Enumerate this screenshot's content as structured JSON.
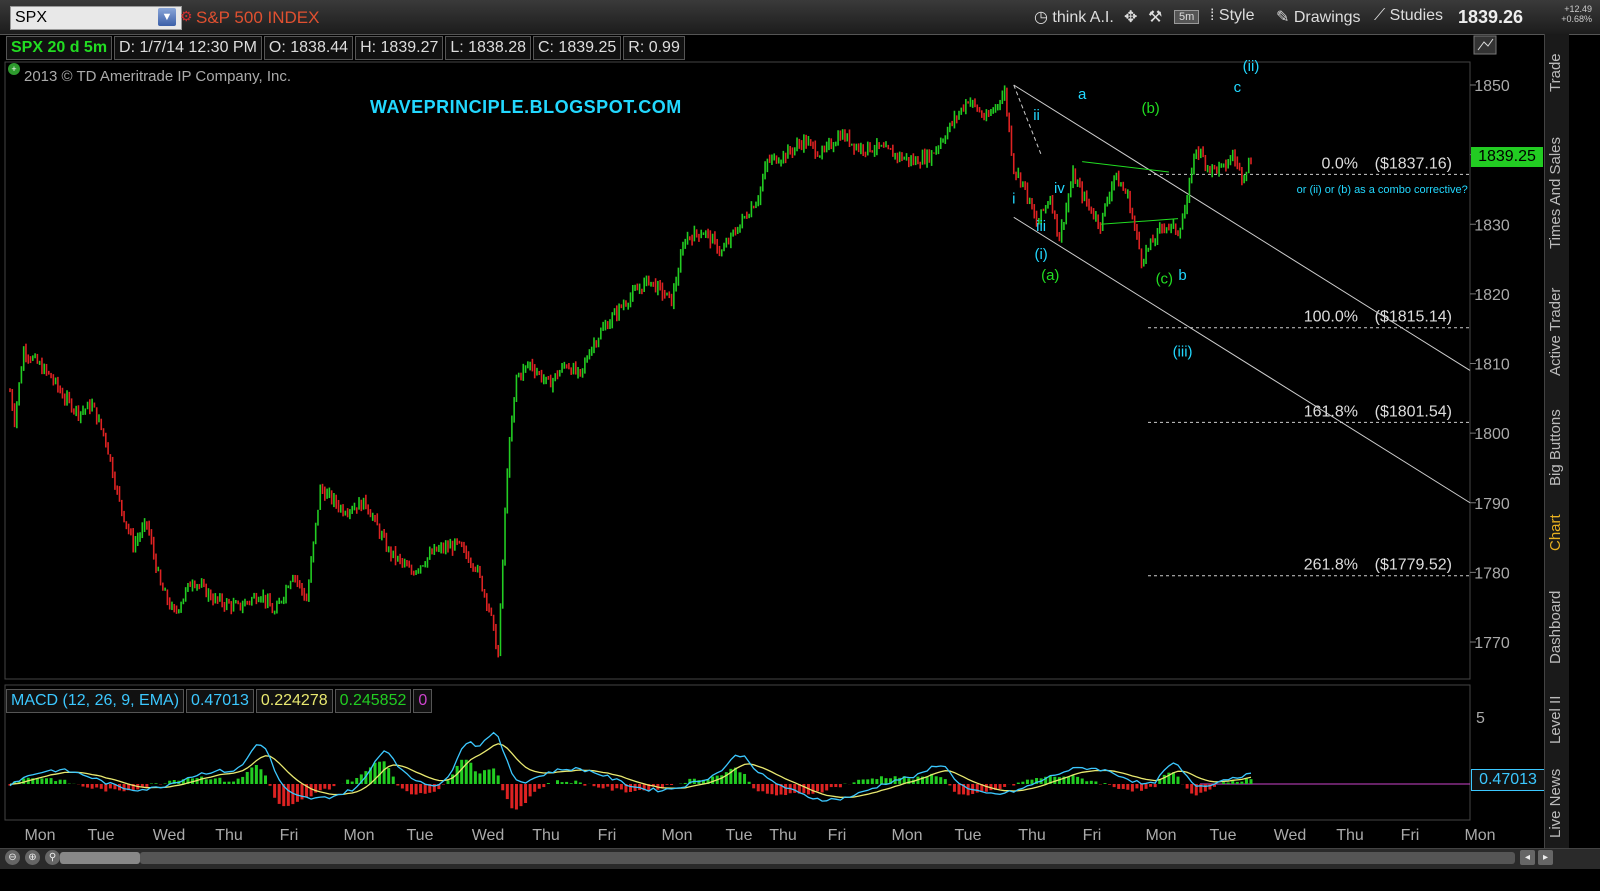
{
  "toolbar": {
    "symbol": "SPX",
    "instrument_name": "S&P 500 INDEX",
    "think_ai": "think A.I.",
    "interval": "5m",
    "style": "Style",
    "drawings": "Drawings",
    "studies": "Studies",
    "last_price": "1839.26",
    "change_abs": "+12.49",
    "change_pct": "+0.68%"
  },
  "info": {
    "symbol_label": "SPX 20 d 5m",
    "date": "D: 1/7/14 12:30 PM",
    "open": "O: 1838.44",
    "high": "H: 1839.27",
    "low": "L: 1838.28",
    "close": "C: 1839.25",
    "range": "R: 0.99"
  },
  "copyright": "2013 © TD Ameritrade IP Company, Inc.",
  "watermark": "WAVEPRINCIPLE.BLOGSPOT.COM",
  "current_price_label": "1839.25",
  "macd": {
    "label": "MACD (12, 26, 9, EMA)",
    "value": "0.47013",
    "avg": "0.224278",
    "diff": "0.245852",
    "zero": "0",
    "current_label": "0.47013",
    "axis_tick": "5"
  },
  "sidebar": [
    "Trade",
    "Times And Sales",
    "Active Trader",
    "Big Buttons",
    "Chart",
    "Dashboard",
    "Level II",
    "Live News"
  ],
  "colors": {
    "up": "#22cc22",
    "down": "#dd2222",
    "macd_line": "#3cc8ff",
    "macd_avg": "#e8e870",
    "annot_green": "#22dd22",
    "annot_cyan": "#22d8ff",
    "channel": "#cfcfcf",
    "zero_line": "#cc44cc"
  },
  "chart_data": {
    "type": "candlestick",
    "x_axis_labels": [
      "Mon",
      "Tue",
      "Wed",
      "Thu",
      "Fri",
      "Mon",
      "Tue",
      "Wed",
      "Thu",
      "Fri",
      "Mon",
      "Tue",
      "Thu",
      "Fri",
      "Mon",
      "Tue",
      "Thu",
      "Fri",
      "Mon",
      "Tue",
      "Wed",
      "Thu",
      "Fri",
      "Mon"
    ],
    "y_ticks": [
      1770,
      1780,
      1790,
      1800,
      1810,
      1820,
      1830,
      1840,
      1850
    ],
    "ylim": [
      1765,
      1855
    ],
    "price_path": [
      [
        0,
        1806
      ],
      [
        1,
        1802
      ],
      [
        3,
        1812
      ],
      [
        6,
        1810
      ],
      [
        9,
        1808
      ],
      [
        12,
        1805
      ],
      [
        15,
        1803
      ],
      [
        18,
        1804
      ],
      [
        21,
        1799
      ],
      [
        24,
        1790
      ],
      [
        27,
        1784
      ],
      [
        30,
        1787
      ],
      [
        33,
        1778
      ],
      [
        36,
        1774
      ],
      [
        40,
        1779
      ],
      [
        45,
        1776
      ],
      [
        50,
        1775
      ],
      [
        55,
        1777
      ],
      [
        58,
        1774
      ],
      [
        62,
        1780
      ],
      [
        65,
        1776
      ],
      [
        68,
        1792
      ],
      [
        73,
        1789
      ],
      [
        78,
        1790
      ],
      [
        83,
        1783
      ],
      [
        88,
        1780
      ],
      [
        93,
        1783
      ],
      [
        98,
        1784
      ],
      [
        102,
        1781
      ],
      [
        105,
        1775
      ],
      [
        107,
        1768
      ],
      [
        109,
        1795
      ],
      [
        111,
        1808
      ],
      [
        114,
        1810
      ],
      [
        118,
        1807
      ],
      [
        122,
        1810
      ],
      [
        125,
        1808
      ],
      [
        127,
        1812
      ],
      [
        130,
        1815
      ],
      [
        135,
        1819
      ],
      [
        140,
        1822
      ],
      [
        145,
        1819
      ],
      [
        148,
        1828
      ],
      [
        152,
        1829
      ],
      [
        156,
        1826
      ],
      [
        160,
        1830
      ],
      [
        164,
        1834
      ],
      [
        166,
        1839
      ],
      [
        170,
        1840
      ],
      [
        174,
        1842
      ],
      [
        178,
        1840
      ],
      [
        182,
        1843
      ],
      [
        186,
        1841
      ],
      [
        190,
        1841
      ],
      [
        194,
        1840
      ],
      [
        198,
        1839
      ],
      [
        202,
        1840
      ],
      [
        206,
        1844
      ],
      [
        210,
        1848
      ],
      [
        214,
        1845
      ],
      [
        218,
        1849
      ],
      [
        220,
        1838
      ],
      [
        222,
        1836
      ],
      [
        225,
        1830
      ],
      [
        228,
        1834
      ],
      [
        230,
        1828
      ],
      [
        233,
        1837
      ],
      [
        236,
        1833
      ],
      [
        239,
        1830
      ],
      [
        242,
        1837
      ],
      [
        245,
        1834
      ],
      [
        248,
        1825
      ],
      [
        250,
        1827
      ],
      [
        253,
        1830
      ],
      [
        256,
        1829
      ],
      [
        258,
        1833
      ],
      [
        259,
        1838
      ],
      [
        260,
        1841
      ],
      [
        263,
        1838
      ],
      [
        266,
        1838
      ],
      [
        268,
        1840
      ],
      [
        270,
        1837
      ],
      [
        272,
        1839.25
      ]
    ],
    "annotations": [
      {
        "text": "(ii)",
        "x": 272,
        "y": 1852,
        "color": "cyan"
      },
      {
        "text": "c",
        "x": 269,
        "y": 1849,
        "color": "cyan"
      },
      {
        "text": "a",
        "x": 235,
        "y": 1848,
        "color": "cyan"
      },
      {
        "text": "(b)",
        "x": 250,
        "y": 1846,
        "color": "green"
      },
      {
        "text": "ii",
        "x": 225,
        "y": 1845,
        "color": "cyan"
      },
      {
        "text": "iv",
        "x": 230,
        "y": 1834.5,
        "color": "cyan"
      },
      {
        "text": "i",
        "x": 220,
        "y": 1833,
        "color": "cyan"
      },
      {
        "text": "iii",
        "x": 226,
        "y": 1829,
        "color": "cyan"
      },
      {
        "text": "(i)",
        "x": 226,
        "y": 1825,
        "color": "cyan"
      },
      {
        "text": "(a)",
        "x": 228,
        "y": 1822,
        "color": "green"
      },
      {
        "text": "(c)",
        "x": 253,
        "y": 1821.5,
        "color": "green"
      },
      {
        "text": "b",
        "x": 257,
        "y": 1822,
        "color": "cyan"
      },
      {
        "text": "(iii)",
        "x": 257,
        "y": 1811,
        "color": "cyan"
      },
      {
        "text": "or (ii) or (b) as a combo corrective?",
        "x": 282,
        "y": 1834.5,
        "color": "cyan",
        "small": true
      }
    ],
    "fib_levels": [
      {
        "label": "0.0%",
        "price_label": "($1837.16)",
        "value": 1837.16
      },
      {
        "label": "100.0%",
        "price_label": "($1815.14)",
        "value": 1815.14
      },
      {
        "label": "161.8%",
        "price_label": "($1801.54)",
        "value": 1801.54
      },
      {
        "label": "261.8%",
        "price_label": "($1779.52)",
        "value": 1779.52
      }
    ],
    "channel": {
      "upper": [
        [
          220,
          1850
        ],
        [
          320,
          1809
        ]
      ],
      "lower": [
        [
          220,
          1831
        ],
        [
          320,
          1790
        ]
      ]
    },
    "macd_series": {
      "ylim": [
        -4,
        7
      ],
      "zero": 0
    }
  }
}
